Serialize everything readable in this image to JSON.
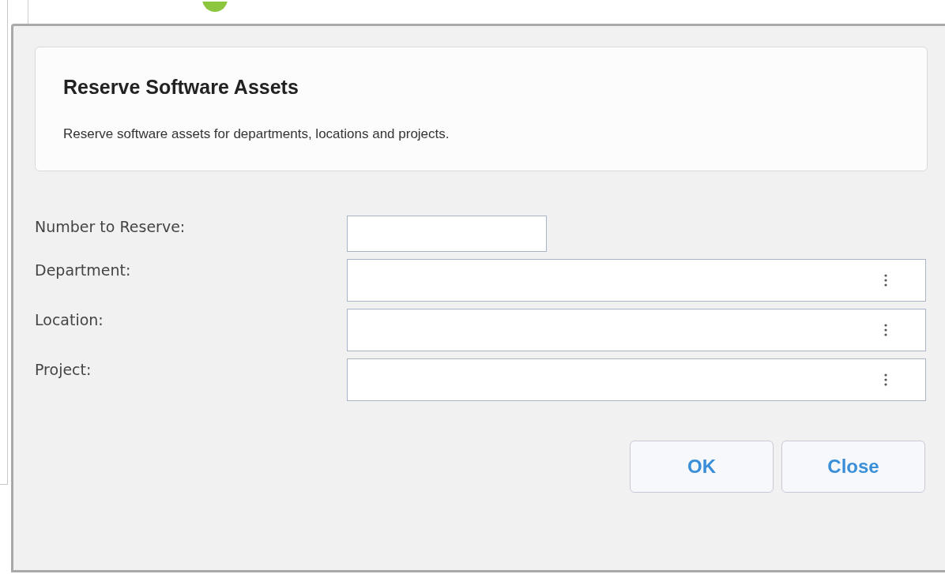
{
  "dialog": {
    "title": "Reserve Software Assets",
    "description": "Reserve software assets for departments, locations and projects.",
    "fields": [
      {
        "label": "Number to Reserve:",
        "kind": "text"
      },
      {
        "label": "Department:",
        "kind": "lookup"
      },
      {
        "label": "Location:",
        "kind": "lookup"
      },
      {
        "label": "Project:",
        "kind": "lookup"
      }
    ],
    "buttons": [
      "OK",
      "Close"
    ]
  }
}
